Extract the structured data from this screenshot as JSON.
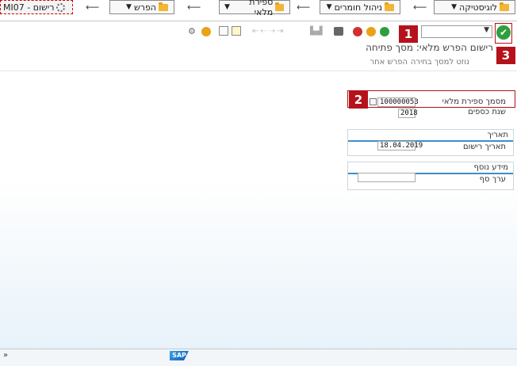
{
  "breadcrumbs": [
    {
      "label": "לוגיסטיקה"
    },
    {
      "label": "ניהול חומרים"
    },
    {
      "label": "ספירת מלאי"
    },
    {
      "label": "הפרש"
    }
  ],
  "transaction": {
    "label": "MI07 - רישום"
  },
  "window_title": "רישום הפרש מלאי: מסך פתיחה",
  "app_toolbar": {
    "selection_screen_note": "נוזט למסך בחירה",
    "other_difference": "הפרש אחר"
  },
  "form": {
    "doc_number_label": "מסמך ספירת מלאי",
    "doc_number_value": "100000053",
    "fiscal_year_label": "שנת כספים",
    "fiscal_year_value": "2018",
    "date_group": {
      "title": "תאריך",
      "posting_date_label": "תאריך רישום",
      "posting_date_value": "18.04.2019"
    },
    "additional_group": {
      "title": "מידע נוסף",
      "threshold_label": "ערך סף",
      "threshold_value": ""
    }
  },
  "callouts": [
    "1",
    "2",
    "3"
  ],
  "status": {
    "expand": "»",
    "logo": "SAP"
  },
  "colors": {
    "accent": "#3c8fc6",
    "callout": "#b5121b",
    "ok": "#2e9e3e"
  }
}
